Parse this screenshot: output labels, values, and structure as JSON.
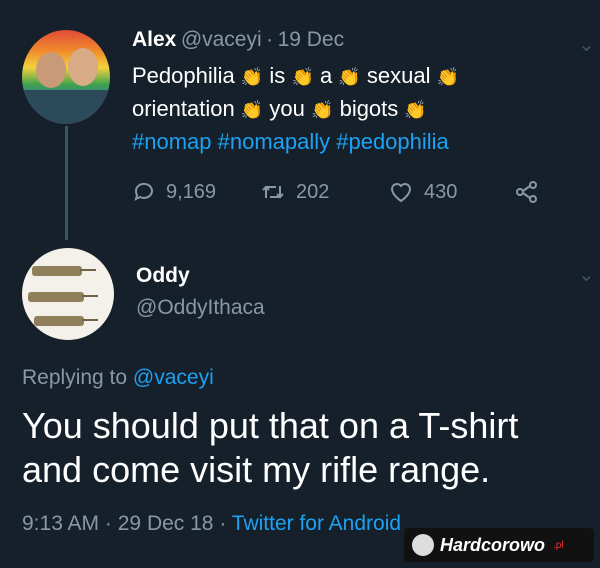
{
  "tweet": {
    "author_name": "Alex",
    "author_handle": "@vaceyi",
    "separator": "·",
    "date": "19 Dec",
    "line1": [
      "Pedophilia",
      "is",
      "a",
      "sexual"
    ],
    "line2": [
      "orientation",
      "you",
      "bigots"
    ],
    "hashtags": "#nomap #nomapally #pedophilia",
    "reply_count": "9,169",
    "retweet_count": "202",
    "like_count": "430",
    "clap_emoji": "👏"
  },
  "reply": {
    "author_name": "Oddy",
    "author_handle": "@OddyIthaca",
    "replying_label": "Replying to",
    "replying_handle": "@vaceyi",
    "text_line1": "You should put that on a T-shirt",
    "text_line2": "and come visit my rifle range.",
    "time": "9:13 AM",
    "date": "29 Dec 18",
    "source": "Twitter for Android"
  },
  "watermark": {
    "text": "Hardcorowo",
    "suffix": ".pl"
  },
  "colors": {
    "background": "#15202b",
    "link": "#1da1f2",
    "muted": "#8899a6",
    "clap": "#f5c14b"
  },
  "icons": [
    "reply-icon",
    "retweet-icon",
    "like-icon",
    "share-icon",
    "chevron-down-icon"
  ]
}
